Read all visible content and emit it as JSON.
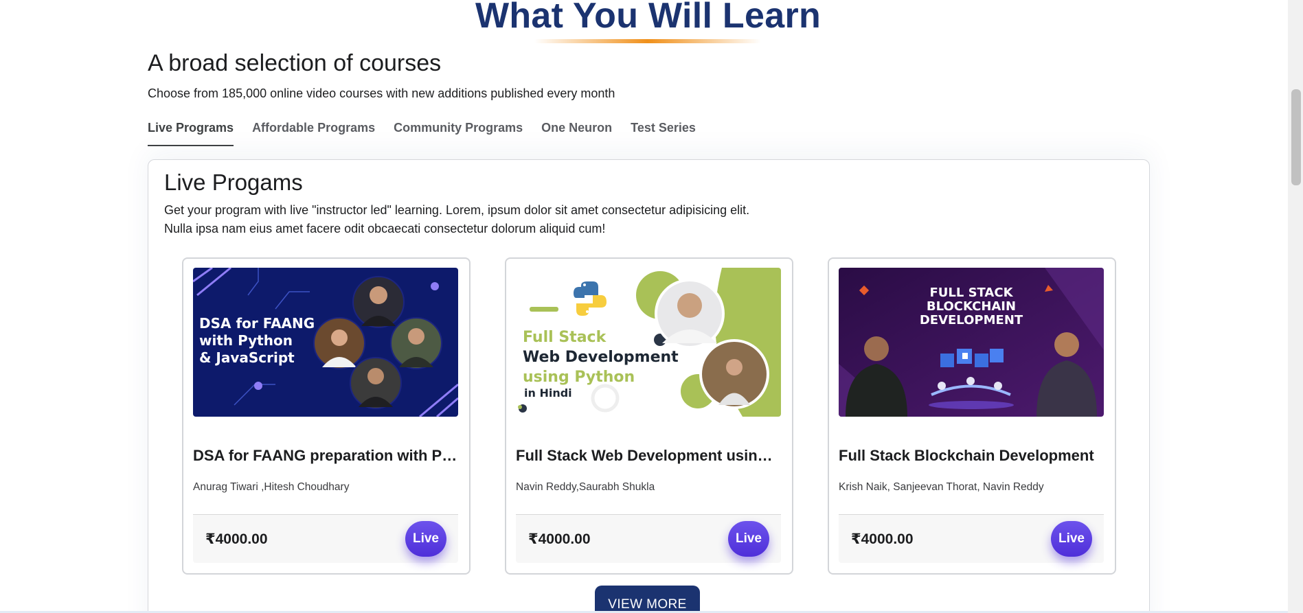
{
  "section": {
    "title": "What You Will Learn"
  },
  "intro": {
    "heading": "A broad selection of courses",
    "description": "Choose from 185,000 online video courses with new additions published every month"
  },
  "tabs": [
    {
      "label": "Live Programs",
      "active": true
    },
    {
      "label": "Affordable Programs",
      "active": false
    },
    {
      "label": "Community Programs",
      "active": false
    },
    {
      "label": "One Neuron",
      "active": false
    },
    {
      "label": "Test Series",
      "active": false
    }
  ],
  "panel": {
    "title": "Live Progams",
    "description_line1": "Get your program with live \"instructor led\" learning. Lorem, ipsum dolor sit amet consectetur adipisicing elit.",
    "description_line2": "Nulla ipsa nam eius amet facere odit obcaecati consectetur dolorum aliquid cum!"
  },
  "courses": [
    {
      "title": "DSA for FAANG preparation with Python & JavaScript",
      "authors": "Anurag Tiwari ,Hitesh Choudhary",
      "price": "₹4000.00",
      "badge": "Live",
      "image_text": [
        "DSA for FAANG",
        "with Python",
        "& JavaScript"
      ],
      "image_bg": "#0d1a6b"
    },
    {
      "title": "Full Stack Web Development using Python in Hindi",
      "authors": "Navin Reddy,Saurabh Shukla",
      "price": "₹4000.00",
      "badge": "Live",
      "image_text": [
        "Full Stack",
        "Web Development",
        "using Python",
        "in Hindi"
      ],
      "image_bg": "#ffffff"
    },
    {
      "title": "Full Stack Blockchain Development",
      "authors": "Krish Naik, Sanjeevan Thorat, Navin Reddy",
      "price": "₹4000.00",
      "badge": "Live",
      "image_text": [
        "FULL STACK",
        "BLOCKCHAIN",
        "DEVELOPMENT"
      ],
      "image_bg": "#3a1057"
    }
  ],
  "view_more_label": "VIEW MORE",
  "colors": {
    "heading_blue": "#1b3370",
    "accent_orange": "#f0901a",
    "live_purple": "#5b3ae3"
  }
}
